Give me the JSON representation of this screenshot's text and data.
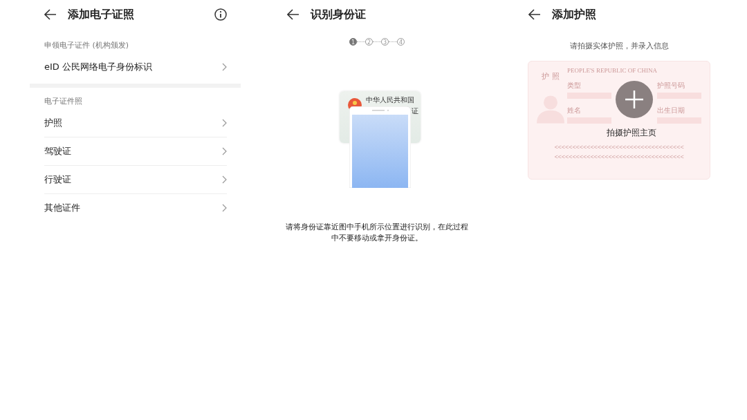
{
  "screens": [
    {
      "kind": "list",
      "title": "添加电子证照",
      "has_info": true,
      "sections": [
        {
          "heading": "申领电子证件 (机构颁发)",
          "items": [
            "eID 公民网络电子身份标识"
          ]
        },
        {
          "heading": "电子证件照",
          "items": [
            "护照",
            "驾驶证",
            "行驶证",
            "其他证件"
          ]
        }
      ]
    },
    {
      "kind": "id_scan",
      "title": "识别身份证",
      "steps": [
        {
          "label": "1",
          "selected": true
        },
        {
          "label": "2",
          "selected": false
        },
        {
          "label": "3",
          "selected": false
        },
        {
          "label": "4",
          "selected": false
        }
      ],
      "card_texts": [
        "中华人民共和国",
        "证"
      ],
      "instruction": "请将身份证靠近图中手机所示位置进行识别，在此过程中不要移动或拿开身份证。"
    },
    {
      "kind": "passport",
      "title": "添加护照",
      "subtitle": "请拍摄实体护照，并录入信息",
      "card": {
        "label": "护 照",
        "country": "PEOPLE'S REPUBLIC OF CHINA",
        "fields": [
          "类型",
          "护照号码",
          "姓名",
          "出生日期"
        ],
        "mrz": [
          "<<<<<<<<<<<<<<<<<<<<<<<<<<<<<<<<<<<<",
          "<<<<<<<<<<<<<<<<<<<<<<<<<<<<<<<<<<<<"
        ]
      },
      "action": "拍摄护照主页"
    }
  ]
}
